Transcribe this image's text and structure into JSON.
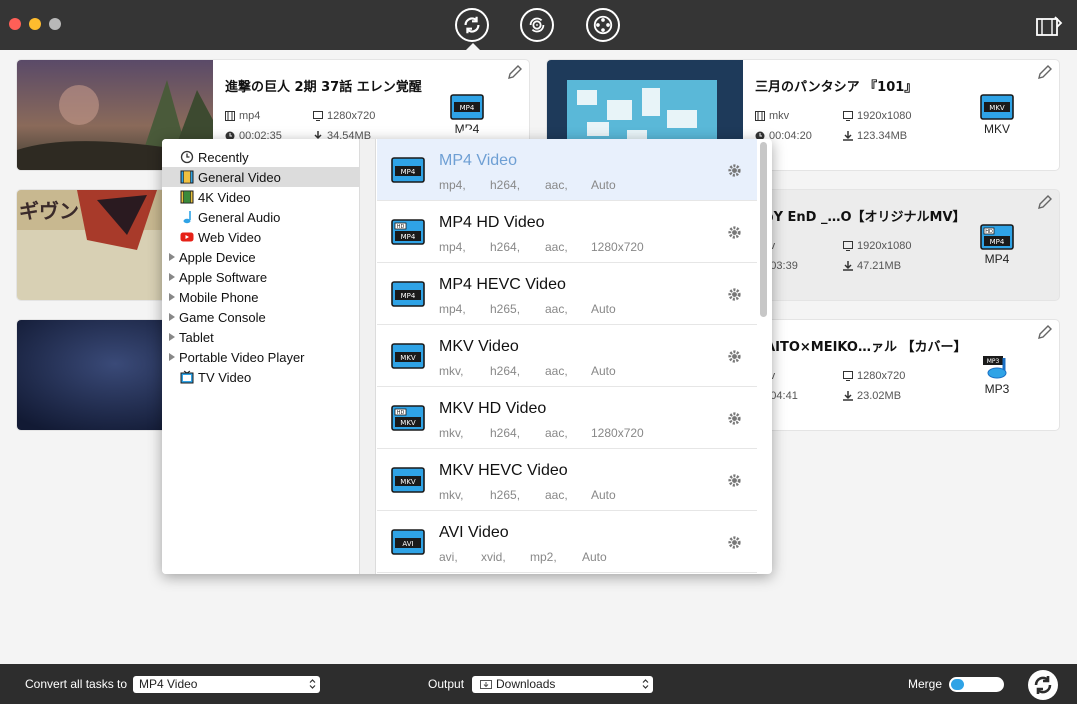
{
  "toolbar": {
    "buttons": [
      "convert",
      "dvd",
      "download"
    ]
  },
  "tasks": [
    {
      "title": "進撃の巨人 2期 37話 エレン覚醒",
      "format": "mp4",
      "resolution": "1280x720",
      "duration": "00:02:35",
      "size": "34.54MB",
      "target": "MP4"
    },
    {
      "title": "三月のパンタシア 『101』",
      "format": "mkv",
      "resolution": "1920x1080",
      "duration": "00:04:20",
      "size": "123.34MB",
      "target": "MKV"
    },
    {
      "title": "ppY EnD _…O【オリジナルMV】",
      "format": "mkv",
      "resolution": "1920x1080",
      "duration": "00:03:39",
      "size": "47.21MB",
      "target": "MP4"
    },
    {
      "title": "KAITO×MEIKO…ァル 【カバー】",
      "format": "mkv",
      "resolution": "1280x720",
      "duration": "00:04:41",
      "size": "23.02MB",
      "target": "MP3"
    }
  ],
  "categories": [
    {
      "label": "Recently",
      "icon": "clock-icon",
      "expandable": false
    },
    {
      "label": "General Video",
      "icon": "film-icon",
      "expandable": false,
      "selected": true
    },
    {
      "label": "4K Video",
      "icon": "4k-icon",
      "expandable": false
    },
    {
      "label": "General Audio",
      "icon": "music-note-icon",
      "expandable": false
    },
    {
      "label": "Web Video",
      "icon": "youtube-icon",
      "expandable": false
    },
    {
      "label": "Apple Device",
      "expandable": true
    },
    {
      "label": "Apple Software",
      "expandable": true
    },
    {
      "label": "Mobile Phone",
      "expandable": true
    },
    {
      "label": "Game Console",
      "expandable": true
    },
    {
      "label": "Tablet",
      "expandable": true
    },
    {
      "label": "Portable Video Player",
      "expandable": true
    },
    {
      "label": "TV Video",
      "icon": "tv-icon",
      "expandable": false
    }
  ],
  "formats": [
    {
      "name": "MP4 Video",
      "badge": "MP4",
      "hd": false,
      "specs": [
        "mp4,",
        "h264,",
        "aac,",
        "Auto"
      ],
      "selected": true
    },
    {
      "name": "MP4 HD Video",
      "badge": "MP4",
      "hd": true,
      "specs": [
        "mp4,",
        "h264,",
        "aac,",
        "1280x720"
      ]
    },
    {
      "name": "MP4 HEVC Video",
      "badge": "MP4",
      "hd": false,
      "specs": [
        "mp4,",
        "h265,",
        "aac,",
        "Auto"
      ]
    },
    {
      "name": "MKV Video",
      "badge": "MKV",
      "hd": false,
      "specs": [
        "mkv,",
        "h264,",
        "aac,",
        "Auto"
      ]
    },
    {
      "name": "MKV HD Video",
      "badge": "MKV",
      "hd": true,
      "specs": [
        "mkv,",
        "h264,",
        "aac,",
        "1280x720"
      ]
    },
    {
      "name": "MKV HEVC Video",
      "badge": "MKV",
      "hd": false,
      "specs": [
        "mkv,",
        "h265,",
        "aac,",
        "Auto"
      ]
    },
    {
      "name": "AVI Video",
      "badge": "AVI",
      "hd": false,
      "specs": [
        "avi,",
        "xvid,",
        "mp2,",
        "Auto"
      ]
    }
  ],
  "bottom": {
    "convert_all_label": "Convert all tasks to",
    "convert_all_value": "MP4 Video",
    "output_label": "Output",
    "output_value": "Downloads",
    "merge_label": "Merge",
    "merge_level": 0.25
  },
  "colors": {
    "accent": "#2fa3e6",
    "selected_format_text": "#6e9fd4",
    "titlebar": "#353535",
    "bottombar": "#2d2d2d"
  }
}
